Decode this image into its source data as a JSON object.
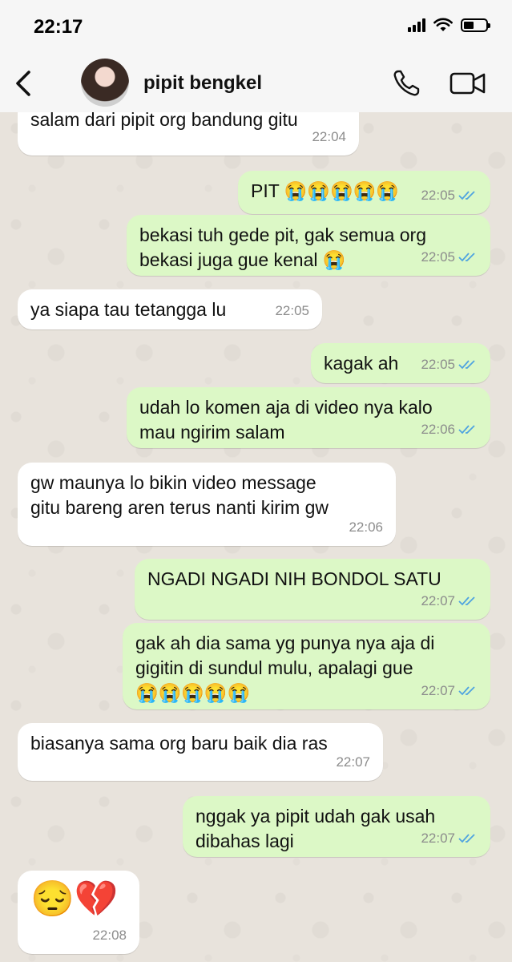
{
  "status_bar": {
    "time": "22:17"
  },
  "header": {
    "contact_name": "pipit bengkel"
  },
  "messages": [
    {
      "dir": "in",
      "text": "salam dari pipit org bandung gitu",
      "time": "22:04"
    },
    {
      "dir": "out",
      "text": "PIT 😭😭😭😭😭",
      "time": "22:05",
      "read": true
    },
    {
      "dir": "out",
      "text": "bekasi tuh gede pit, gak semua org\nbekasi juga gue kenal 😭",
      "time": "22:05",
      "read": true
    },
    {
      "dir": "in",
      "text": "ya siapa tau tetangga lu",
      "time": "22:05"
    },
    {
      "dir": "out",
      "text": "kagak ah",
      "time": "22:05",
      "read": true
    },
    {
      "dir": "out",
      "text": "udah lo komen aja di video nya kalo\nmau ngirim salam",
      "time": "22:06",
      "read": true
    },
    {
      "dir": "in",
      "text": "gw maunya lo bikin video message\ngitu bareng aren terus nanti kirim gw",
      "time": "22:06"
    },
    {
      "dir": "out",
      "text": "NGADI NGADI NIH BONDOL SATU",
      "time": "22:07",
      "read": true
    },
    {
      "dir": "out",
      "text": "gak ah dia sama yg punya nya aja di\ngigitin di sundul mulu, apalagi gue\n😭😭😭😭😭",
      "time": "22:07",
      "read": true
    },
    {
      "dir": "in",
      "text": "biasanya sama org baru baik dia ras",
      "time": "22:07"
    },
    {
      "dir": "out",
      "text": "nggak ya pipit udah gak usah\ndibahas lagi",
      "time": "22:07",
      "read": true
    },
    {
      "dir": "in",
      "text": "😔💔",
      "time": "22:08"
    }
  ],
  "colors": {
    "incoming_bubble": "#ffffff",
    "outgoing_bubble": "#dcf8c6",
    "read_ticks": "#4fa3e0"
  },
  "icons": [
    "back-chevron-icon",
    "phone-icon",
    "video-camera-icon",
    "double-check-icon"
  ]
}
